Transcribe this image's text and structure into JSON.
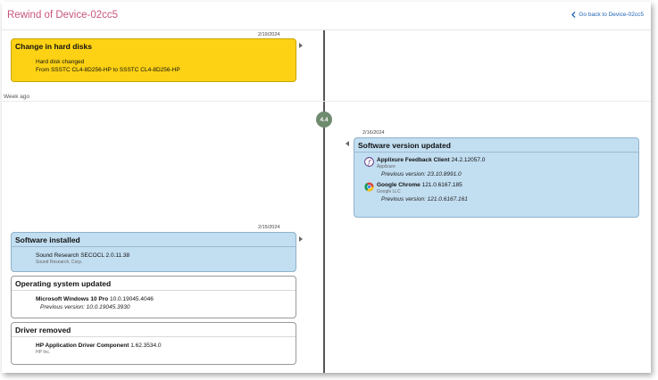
{
  "header": {
    "title": "Rewind of Device-02cc5",
    "back_label": "Go back to Device-02cc5"
  },
  "timeline": {
    "week_label": "Week ago",
    "node_label": "4.4"
  },
  "left": {
    "date_1": "2/19/2024",
    "date_2": "2/15/2024",
    "hard_disks": {
      "title": "Change in hard disks",
      "line1": "Hard disk changed",
      "line2": "From SSSTC CL4-8D256-HP to SSSTC CL4-8D256-HP"
    },
    "software_installed": {
      "title": "Software installed",
      "item_name": "Sound Research SECOCL",
      "item_version": "2.0.11.38",
      "item_vendor": "Sound Research, Corp."
    },
    "os_updated": {
      "title": "Operating system updated",
      "item_name": "Microsoft Windows 10 Pro",
      "item_version": "10.0.19045.4046",
      "previous": "Previous version: 10.0.19045.3930"
    },
    "driver_removed": {
      "title": "Driver removed",
      "item_name": "HP Application Driver Component",
      "item_version": "1.62.3534.0",
      "item_vendor": "HP Inc."
    }
  },
  "right": {
    "date": "2/16/2024",
    "software_updated": {
      "title": "Software version updated",
      "items": [
        {
          "name": "Applixure Feedback Client",
          "version": "24.2.12057.0",
          "vendor": "Applixure",
          "previous": "Previous version: 23.10.8991.0",
          "icon": "applixure-icon"
        },
        {
          "name": "Google Chrome",
          "version": "121.0.6167.185",
          "vendor": "Google LLC",
          "previous": "Previous version: 121.0.6167.161",
          "icon": "chrome-icon"
        }
      ]
    }
  },
  "colors": {
    "title": "#c9547e",
    "link": "#1e63b5",
    "yellow_card": "#fdd214",
    "blue_card": "#c2def1",
    "node": "#6e8b6e"
  }
}
